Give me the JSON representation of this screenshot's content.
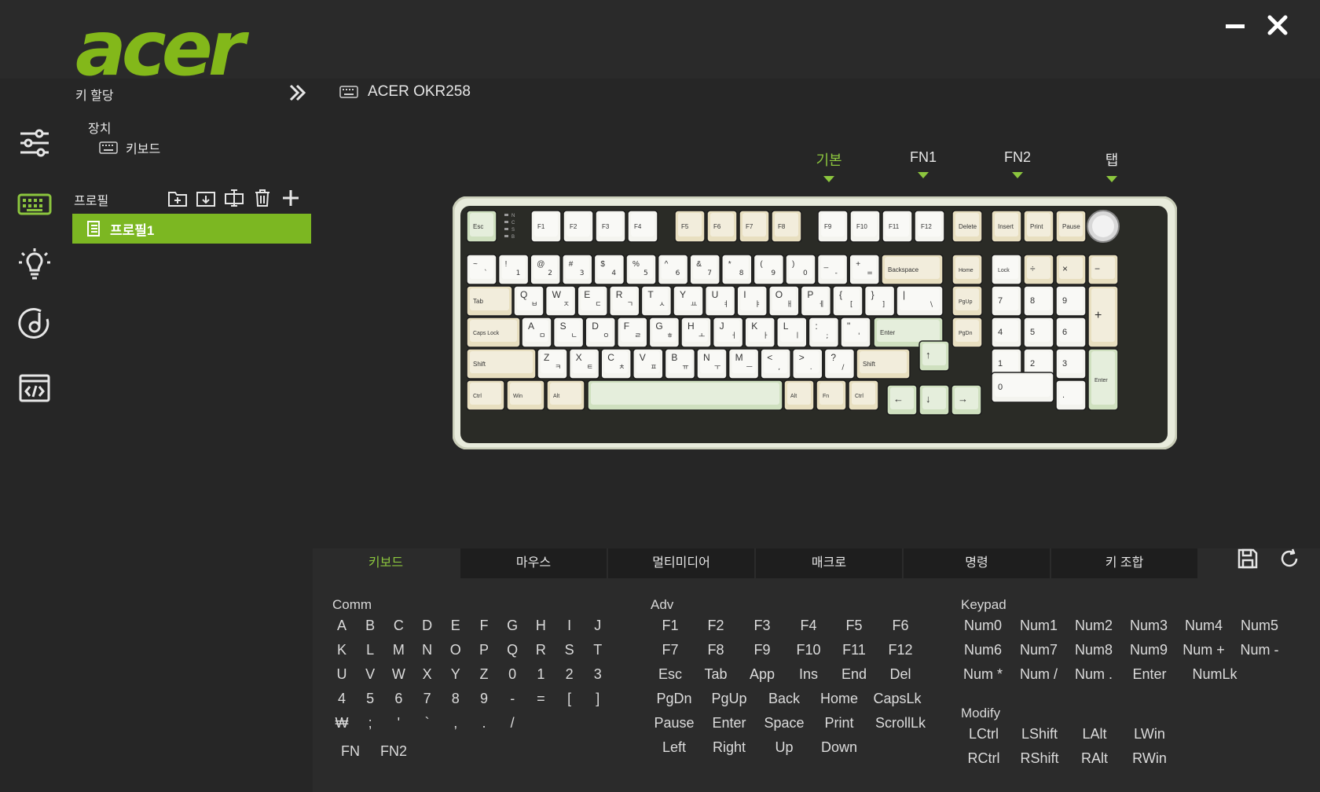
{
  "brand": {
    "logo_text": "acer",
    "color": "#83b81a"
  },
  "window": {
    "minimize_icon": "minus-icon",
    "close_icon": "close-x-icon"
  },
  "sidebar": {
    "title": "키 할당",
    "device_header": "장치",
    "device_item": "키보드",
    "profile_header": "프로필",
    "profile_item": "프로필1"
  },
  "device": {
    "name": "ACER OKR258"
  },
  "layers": [
    {
      "label": "기본",
      "active": true
    },
    {
      "label": "FN1"
    },
    {
      "label": "FN2"
    },
    {
      "label": "탭"
    }
  ],
  "tabs": [
    {
      "label": "키보드",
      "active": true
    },
    {
      "label": "마우스"
    },
    {
      "label": "멀티미디어"
    },
    {
      "label": "매크로"
    },
    {
      "label": "명령"
    },
    {
      "label": "키 조합"
    }
  ],
  "sections": {
    "comm": {
      "title": "Comm",
      "rows": [
        [
          "A",
          "B",
          "C",
          "D",
          "E",
          "F",
          "G",
          "H",
          "I",
          "J"
        ],
        [
          "K",
          "L",
          "M",
          "N",
          "O",
          "P",
          "Q",
          "R",
          "S",
          "T"
        ],
        [
          "U",
          "V",
          "W",
          "X",
          "Y",
          "Z",
          "0",
          "1",
          "2",
          "3"
        ],
        [
          "4",
          "5",
          "6",
          "7",
          "8",
          "9",
          "-",
          "=",
          "[",
          "]"
        ],
        [
          "₩",
          ";",
          "'",
          "`",
          ",",
          ".",
          "/"
        ]
      ],
      "extra": [
        "FN",
        "FN2"
      ]
    },
    "adv": {
      "title": "Adv",
      "rows": [
        [
          "F1",
          "F2",
          "F3",
          "F4",
          "F5",
          "F6"
        ],
        [
          "F7",
          "F8",
          "F9",
          "F10",
          "F11",
          "F12"
        ],
        [
          "Esc",
          "Tab",
          "App",
          "Ins",
          "End",
          "Del"
        ],
        [
          "PgDn",
          "PgUp",
          "Back",
          "Home",
          "CapsLk"
        ],
        [
          "Pause",
          "Enter",
          "Space",
          "Print",
          "ScrollLk"
        ],
        [
          "Left",
          "Right",
          "Up",
          "Down"
        ]
      ]
    },
    "keypad": {
      "title": "Keypad",
      "rows": [
        [
          "Num0",
          "Num1",
          "Num2",
          "Num3",
          "Num4",
          "Num5"
        ],
        [
          "Num6",
          "Num7",
          "Num8",
          "Num9",
          "Num +",
          "Num -"
        ],
        [
          "Num *",
          "Num /",
          "Num .",
          "Enter",
          "NumLk"
        ]
      ]
    },
    "modify": {
      "title": "Modify",
      "rows": [
        [
          "LCtrl",
          "LShift",
          "LAlt",
          "LWin"
        ],
        [
          "RCtrl",
          "RShift",
          "RAlt",
          "RWin"
        ]
      ]
    }
  },
  "keyboard_keys": {
    "fn_row": [
      "Esc",
      "F1",
      "F2",
      "F3",
      "F4",
      "F5",
      "F6",
      "F7",
      "F8",
      "F9",
      "F10",
      "F11",
      "F12",
      "Delete",
      "Insert",
      "Print",
      "Pause"
    ],
    "row1": [
      "~",
      "!",
      "@",
      "#",
      "$",
      "%",
      "^",
      "&",
      "*",
      "(",
      ")",
      "_",
      "+",
      "Backspace",
      "Home",
      "Lock",
      "÷",
      "×",
      "−"
    ],
    "row1_sub": [
      "`",
      "1",
      "2",
      "3",
      "4",
      "5",
      "6",
      "7",
      "8",
      "9",
      "0",
      "-",
      "=",
      "",
      "",
      "",
      "",
      "",
      ""
    ],
    "row2": [
      "Tab",
      "Q",
      "W",
      "E",
      "R",
      "T",
      "Y",
      "U",
      "I",
      "O",
      "P",
      "{",
      "}",
      "|",
      "PgUp",
      "7",
      "8",
      "9",
      "+"
    ],
    "row2_sub": [
      "",
      "ㅂ",
      "ㅈ",
      "ㄷ",
      "ㄱ",
      "ㅅ",
      "ㅛ",
      "ㅕ",
      "ㅑ",
      "ㅐ",
      "ㅔ",
      "[",
      "]",
      "\\",
      "",
      "",
      "",
      "",
      ""
    ],
    "row3": [
      "Caps Lock",
      "A",
      "S",
      "D",
      "F",
      "G",
      "H",
      "J",
      "K",
      "L",
      ":",
      "\"",
      "Enter",
      "PgDn",
      "4",
      "5",
      "6"
    ],
    "row3_sub": [
      "",
      "ㅁ",
      "ㄴ",
      "ㅇ",
      "ㄹ",
      "ㅎ",
      "ㅗ",
      "ㅓ",
      "ㅏ",
      "ㅣ",
      ";",
      "'",
      "",
      "",
      "",
      "",
      ""
    ],
    "row4": [
      "Shift",
      "Z",
      "X",
      "C",
      "V",
      "B",
      "N",
      "M",
      "<",
      ">",
      "?",
      "Shift",
      "↑",
      "1",
      "2",
      "3",
      "Enter"
    ],
    "row4_sub": [
      "",
      "ㅋ",
      "ㅌ",
      "ㅊ",
      "ㅍ",
      "ㅠ",
      "ㅜ",
      "ㅡ",
      ",",
      ".",
      "/",
      "",
      "",
      "",
      "",
      "",
      ""
    ],
    "row5": [
      "Ctrl",
      "Win",
      "Alt",
      "",
      "Alt",
      "Fn",
      "Ctrl",
      "←",
      "↓",
      "→",
      "0",
      "."
    ],
    "indicators": [
      "N",
      "C",
      "S",
      "B"
    ]
  }
}
